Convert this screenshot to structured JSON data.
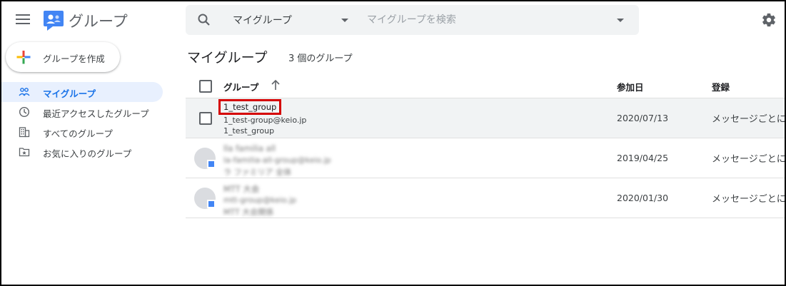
{
  "app": {
    "title": "グループ",
    "menu_icon": "hamburger-menu-icon",
    "logo_icon": "google-groups-logo"
  },
  "search": {
    "scope_label": "マイグループ",
    "placeholder": "マイグループを検索",
    "icon": "search-icon",
    "settings_icon": "gear-icon"
  },
  "sidebar": {
    "create_label": "グループを作成",
    "items": [
      {
        "label": "マイグループ",
        "icon": "people-icon",
        "active": true
      },
      {
        "label": "最近アクセスしたグループ",
        "icon": "clock-icon",
        "active": false
      },
      {
        "label": "すべてのグループ",
        "icon": "building-icon",
        "active": false
      },
      {
        "label": "お気に入りのグループ",
        "icon": "star-folder-icon",
        "active": false
      }
    ]
  },
  "main": {
    "title": "マイグループ",
    "count_text": "3 個のグループ",
    "columns": {
      "group": "グループ",
      "joined": "参加日",
      "subscription": "登録"
    },
    "rows": [
      {
        "name": "1_test_group",
        "email": "1_test-group@keio.jp",
        "description": "1_test_group",
        "joined": "2020/07/13",
        "subscription": "メッセージごとに"
      },
      {
        "name": "lla familia all",
        "email": "la-familia-all-group@keio.jp",
        "description": "ラ ファミリア 全体",
        "joined": "2019/04/25",
        "subscription": "メッセージごとに"
      },
      {
        "name": "MTT 大会",
        "email": "mtt-group@keio.jp",
        "description": "MTT 大会関係",
        "joined": "2020/01/30",
        "subscription": "メッセージごとに"
      }
    ]
  },
  "colors": {
    "accent": "#1a73e8",
    "active_bg": "#e8f0fe",
    "highlight_border": "#d50000"
  }
}
